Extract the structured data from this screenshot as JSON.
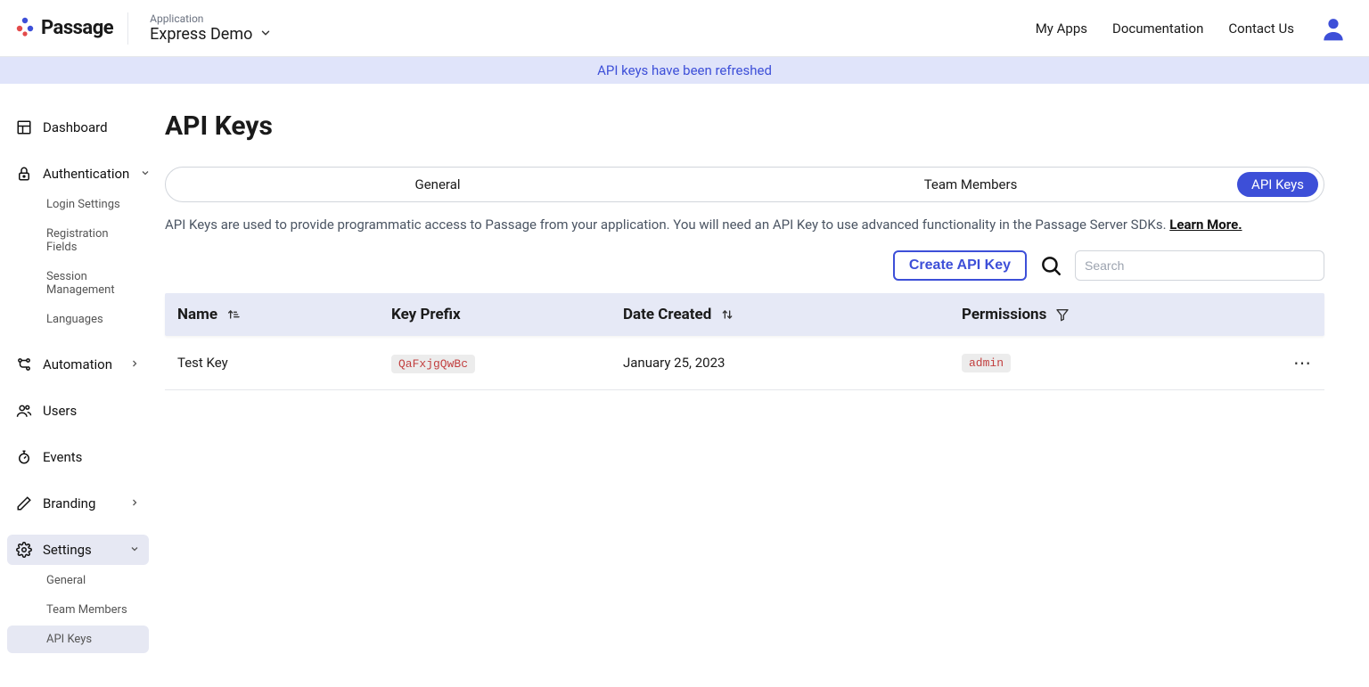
{
  "brand": {
    "name": "Passage"
  },
  "app_switcher": {
    "label": "Application",
    "name": "Express Demo"
  },
  "topnav": {
    "my_apps": "My Apps",
    "documentation": "Documentation",
    "contact": "Contact Us"
  },
  "banner": "API keys have been refreshed",
  "sidebar": {
    "dashboard": "Dashboard",
    "auth": {
      "label": "Authentication",
      "login": "Login Settings",
      "reg": "Registration Fields",
      "session": "Session Management",
      "lang": "Languages"
    },
    "automation": "Automation",
    "users": "Users",
    "events": "Events",
    "branding": "Branding",
    "settings": {
      "label": "Settings",
      "general": "General",
      "team": "Team Members",
      "apikeys": "API Keys"
    }
  },
  "page": {
    "title": "API Keys"
  },
  "tabs": {
    "general": "General",
    "team": "Team Members",
    "apikeys": "API Keys"
  },
  "description": {
    "text": "API Keys are used to provide programmatic access to Passage from your application. You will need an API Key to use advanced functionality in the Passage Server SDKs. ",
    "learn_more": "Learn More."
  },
  "controls": {
    "create": "Create API Key",
    "search_placeholder": "Search"
  },
  "table": {
    "headers": {
      "name": "Name",
      "prefix": "Key Prefix",
      "date": "Date Created",
      "perm": "Permissions"
    },
    "rows": [
      {
        "name": "Test Key",
        "prefix": "QaFxjgQwBc",
        "date": "January 25, 2023",
        "perm": "admin"
      }
    ]
  }
}
